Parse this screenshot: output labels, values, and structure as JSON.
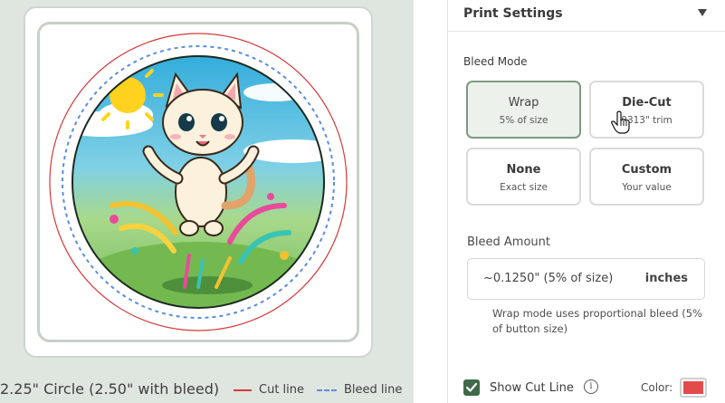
{
  "preview": {
    "caption": "2.25\" Circle (2.50\" with bleed)",
    "legend": {
      "cut_label": "Cut line",
      "bleed_label": "Bleed line"
    },
    "colors": {
      "cut_line": "#d43a3a",
      "bleed_line": "#5b8ee0"
    }
  },
  "panel": {
    "title": "Print Settings",
    "bleed_mode": {
      "label": "Bleed Mode",
      "options": [
        {
          "title": "Wrap",
          "subtitle": "5% of size",
          "selected": true
        },
        {
          "title": "Die-Cut",
          "subtitle": "0313\" trim",
          "selected": false
        },
        {
          "title": "None",
          "subtitle": "Exact size",
          "selected": false
        },
        {
          "title": "Custom",
          "subtitle": "Your value",
          "selected": false
        }
      ]
    },
    "bleed_amount": {
      "label": "Bleed Amount",
      "value": "~0.1250\" (5% of size)",
      "unit": "inches",
      "help": "Wrap mode uses proportional bleed (5% of button size)"
    },
    "cut_line": {
      "label": "Show Cut Line",
      "checked": true,
      "info_glyph": "i",
      "color_label": "Color:",
      "color": "#e34b4b"
    }
  }
}
